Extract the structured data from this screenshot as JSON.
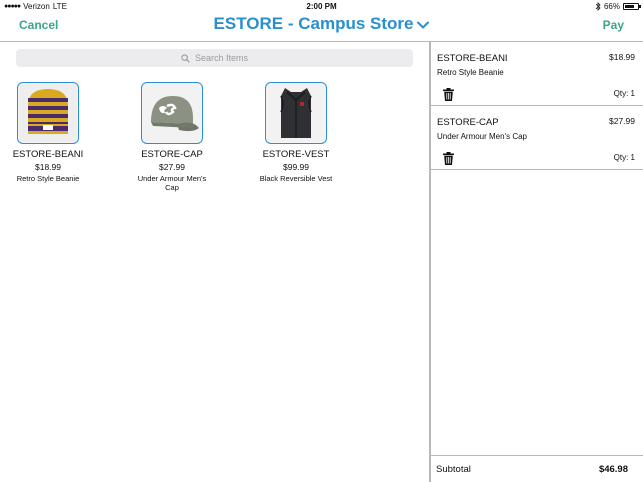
{
  "status_bar": {
    "carrier": "Verizon",
    "network": "LTE",
    "time": "2:00 PM",
    "battery": "66%",
    "battery_level": 0.66
  },
  "nav": {
    "cancel_label": "Cancel",
    "title": "ESTORE - Campus Store",
    "pay_label": "Pay",
    "accent_color": "#3aa68c",
    "title_color": "#2b8fcf"
  },
  "search": {
    "placeholder": "Search Items"
  },
  "products": [
    {
      "sku": "ESTORE-BEANI",
      "price": "$18.99",
      "description": "Retro Style Beanie",
      "image": "beanie"
    },
    {
      "sku": "ESTORE-CAP",
      "price": "$27.99",
      "description": "Under Armour Men's Cap",
      "image": "cap"
    },
    {
      "sku": "ESTORE-VEST",
      "price": "$99.99",
      "description": "Black Reversible Vest",
      "image": "vest"
    }
  ],
  "cart": {
    "items": [
      {
        "sku": "ESTORE-BEANI",
        "price": "$18.99",
        "description": "Retro Style Beanie",
        "qty": "Qty: 1"
      },
      {
        "sku": "ESTORE-CAP",
        "price": "$27.99",
        "description": "Under Armour Men's Cap",
        "qty": "Qty: 1"
      }
    ],
    "subtotal_label": "Subtotal",
    "subtotal_value": "$46.98"
  }
}
